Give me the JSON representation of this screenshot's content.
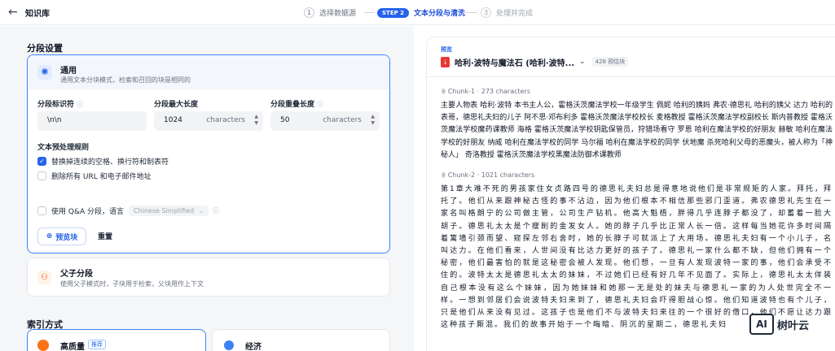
{
  "header": {
    "back_icon": "arrow-left-icon",
    "title": "知识库",
    "steps": [
      {
        "num": "1",
        "label": "选择数据源"
      },
      {
        "pill": "STEP 2",
        "label": "文本分段与清洗"
      },
      {
        "num": "3",
        "label": "处理并完成"
      }
    ]
  },
  "segment": {
    "section_title": "分段设置",
    "general": {
      "title": "通用",
      "desc": "通用文本分块模式，检索和召回的块是相同的",
      "icon": "gear-icon"
    },
    "fields": {
      "separator_label": "分段标识符",
      "separator_value": "\\n\\n",
      "max_length_label": "分段最大长度",
      "max_length_value": "1024",
      "max_length_unit": "characters",
      "overlap_label": "分段重叠长度",
      "overlap_value": "50",
      "overlap_unit": "characters"
    },
    "preprocess": {
      "title": "文本预处理规则",
      "rule1": "替换掉连续的空格、换行符和制表符",
      "rule2": "删除所有 URL 和电子邮件地址"
    },
    "qa": {
      "label": "使用 Q&A 分段，语言",
      "language": "Chinese Simplified"
    },
    "preview_button": "预览块",
    "reset_button": "重置",
    "parent_child": {
      "title": "父子分段",
      "desc": "使用父子模式时，子块用于检索，父块用作上下文",
      "icon": "people-icon"
    }
  },
  "index": {
    "section_title": "索引方式",
    "high_quality": "高质量",
    "recommended_badge": "推荐",
    "economy": "经济"
  },
  "preview": {
    "label": "预览",
    "doc_name": "哈利·波特与魔法石 (哈利·波特...",
    "count": "428 预估块",
    "chunks": [
      {
        "title": "Chunk-1 · 273 characters",
        "text": "主要人物表 哈利·波特 本书主人公，霍格沃茨魔法学校一年级学生 佩妮 哈利的姨妈 弗农·德思礼 哈利的姨父 达力 哈利的表哥，德思礼夫妇的儿子 阿不思·邓布利多 霍格沃茨魔法学校校长 麦格教授 霍格沃茨魔法学校副校长 斯内普教授 霍格沃茨魔法学校魔药课教师 海格 霍格沃茨魔法学校钥匙保管员，狩猎场看守 罗恩 哈利在魔法学校的好朋友 赫敏 哈利在魔法学校的好朋友 纳威 哈利在魔法学校的同学 马尔福 哈利在魔法学校的同学 伏地魔 杀死哈利父母的恶魔头，被人称为「神秘人」 奇洛教授 霍格沃茨魔法学校黑魔法防御术课教师"
      },
      {
        "title": "Chunk-2 · 1021 characters",
        "text": "第1章大难不死的男孩家住女贞路四号的德思礼夫妇总是得意地说他们是非常规矩的人家。拜托，拜托了。他们从来跟神秘古怪的事不沾边，因为他们根本不相信那些邪门歪道。弗农德思礼先生在一家名叫格朗宁的公司做主管，公司生产钻机。他高大魁梧，胖得几乎连脖子都没了，却蓄着一脸大胡子。德思礼太太是个瘦削的金发女人。她的脖子几乎比正常人长一倍。这样每当她花许多时间隔着篱墙引颈而望、窥探左邻右舍时，她的长脖子可就派上了大用场。德思礼夫妇有一个小儿子，名叫达力。在他们看来，人世间没有比达力更好的孩子了。德思礼一家什么都不缺，但他们拥有一个秘密，他们最害怕的就是这秘密会被人发现。他们想，一旦有人发现波特一家的事，他们会承受不住的。波特太太是德思礼太太的妹妹，不过她们已经有好几年不见面了。实际上，德思礼太太佯装自己根本没有这么个妹妹，因为她妹妹和她那一无是处的妹夫与德思礼一家的为人处世完全不一样。一想到邻居们会说波特夫妇来到了，德思礼夫妇会吓得胆战心惊。他们知道波特也有个儿子，只是他们从来没有见过。这孩子也是他们不与波特夫妇来往的一个很好的借口，他们不愿让达力跟这种孩子厮混。我们的故事开始于一个晦暗、阴沉的星期二，德思礼夫妇"
      }
    ]
  },
  "watermark": {
    "badge": "AI",
    "text": "树叶云"
  },
  "colors": {
    "accent": "#2563eb",
    "orange": "#f97316",
    "pdf": "#e53935"
  }
}
